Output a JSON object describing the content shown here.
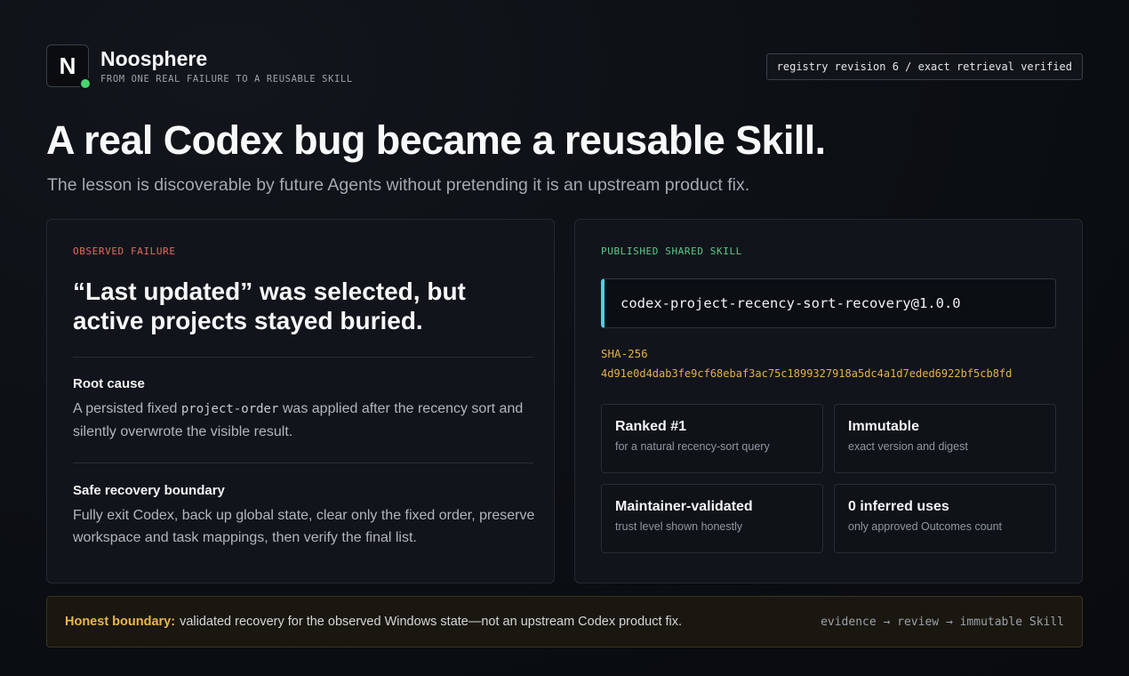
{
  "brand": {
    "logo_letter": "N",
    "name": "Noosphere",
    "tagline": "FROM ONE REAL FAILURE TO A REUSABLE SKILL",
    "status_color": "#4ad46f"
  },
  "registry": {
    "label": "registry revision 6 / exact retrieval verified"
  },
  "hero": {
    "title": "A real Codex bug became a reusable Skill.",
    "subtitle": "The lesson is discoverable by future Agents without pretending it is an upstream product fix."
  },
  "failure": {
    "eyebrow": "OBSERVED FAILURE",
    "title": "“Last updated” was selected, but active projects stayed buried.",
    "root_cause": {
      "heading": "Root cause",
      "before": "A persisted fixed ",
      "code": "project-order",
      "after": " was applied after the recency sort and silently overwrote the visible result."
    },
    "recovery": {
      "heading": "Safe recovery boundary",
      "body": "Fully exit Codex, back up global state, clear only the fixed order, preserve workspace and task mappings, then verify the final list."
    }
  },
  "skill": {
    "eyebrow": "PUBLISHED SHARED SKILL",
    "id": "codex-project-recency-sort-recovery@1.0.0",
    "sha_label": "SHA-256",
    "sha_value": "4d91e0d4dab3fe9cf68ebaf3ac75c1899327918a5dc4a1d7eded6922bf5cb8fd",
    "cards": [
      {
        "title": "Ranked #1",
        "sub": "for a natural recency-sort query"
      },
      {
        "title": "Immutable",
        "sub": "exact version and digest"
      },
      {
        "title": "Maintainer-validated",
        "sub": "trust level shown honestly"
      },
      {
        "title": "0 inferred uses",
        "sub": "only approved Outcomes count"
      }
    ]
  },
  "footer": {
    "strong": "Honest boundary:",
    "text": "validated recovery for the observed Windows state—not an upstream Codex product fix.",
    "flow": "evidence → review → immutable Skill"
  },
  "colors": {
    "accent_cyan": "#4fd1e0",
    "accent_amber": "#e3b04b",
    "failure_red": "#e06a5d",
    "skill_green": "#58c88a"
  }
}
